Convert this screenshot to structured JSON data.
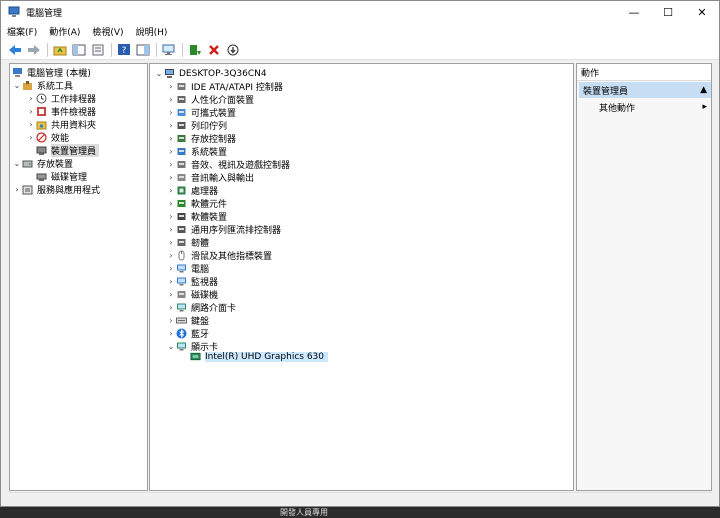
{
  "window": {
    "title": "電腦管理"
  },
  "window_controls": {
    "minimize": "—",
    "maximize": "☐",
    "close": "✕"
  },
  "menu": [
    "檔案(F)",
    "動作(A)",
    "檢視(V)",
    "說明(H)"
  ],
  "left_tree": {
    "root": "電腦管理 (本機)",
    "system_tools": "系統工具",
    "task_scheduler": "工作排程器",
    "event_viewer": "事件檢視器",
    "shared_folders": "共用資料夾",
    "performance": "效能",
    "device_manager": "裝置管理員",
    "storage": "存放裝置",
    "disk_management": "磁碟管理",
    "services": "服務與應用程式"
  },
  "device_tree": {
    "computer": "DESKTOP-3Q36CN4",
    "categories": [
      "IDE ATA/ATAPI 控制器",
      "人性化介面裝置",
      "可攜式裝置",
      "列印佇列",
      "存放控制器",
      "系統裝置",
      "音效、視訊及遊戲控制器",
      "音訊輸入與輸出",
      "處理器",
      "軟體元件",
      "軟體裝置",
      "通用序列匯流排控制器",
      "韌體",
      "滑鼠及其他指標裝置",
      "電腦",
      "監視器",
      "磁碟機",
      "網路介面卡",
      "鍵盤",
      "藍牙",
      "顯示卡"
    ],
    "display_child": "Intel(R) UHD Graphics 630"
  },
  "actions": {
    "header": "動作",
    "section": "裝置管理員",
    "more": "其他動作"
  },
  "taskbar_hint": "開發人員專用"
}
